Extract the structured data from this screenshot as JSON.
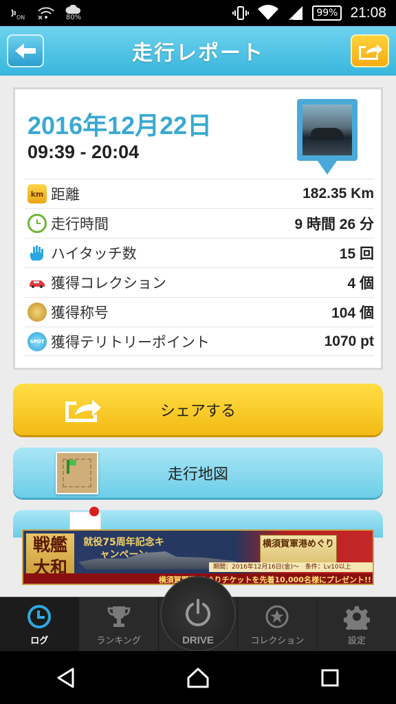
{
  "status_bar": {
    "battery": "99%",
    "time": "21:08",
    "data_label": "80%",
    "on_label": "ON"
  },
  "header": {
    "title": "走行レポート"
  },
  "report": {
    "date": "2016年12月22日",
    "time_range": "09:39 - 20:04",
    "stats": [
      {
        "icon": "km-icon",
        "icon_text": "km",
        "label": "距離",
        "value": "182.35 Km"
      },
      {
        "icon": "clock-icon",
        "icon_text": "",
        "label": "走行時間",
        "value": "9 時間 26 分"
      },
      {
        "icon": "high-touch-hand-icon",
        "icon_text": "",
        "label": "ハイタッチ数",
        "value": "15 回"
      },
      {
        "icon": "car-collection-icon",
        "icon_text": "",
        "label": "獲得コレクション",
        "value": "4 個"
      },
      {
        "icon": "medal-icon",
        "icon_text": "",
        "label": "獲得称号",
        "value": "104 個"
      },
      {
        "icon": "spot-icon",
        "icon_text": "SPOT",
        "label": "獲得テリトリーポイント",
        "value": "1070 pt"
      }
    ]
  },
  "actions": {
    "share_label": "シェアする",
    "map_label": "走行地図"
  },
  "ad": {
    "kanji": "戦艦大和",
    "campaign": "就役75周年記念キャンペーン",
    "port": "横須賀軍港めぐり",
    "period": "期間：2016年12月16日(金)〜　条件：Lv10以上",
    "bottom": "横須賀軍港 めぐりチケットを先着10,000名様にプレゼント!!"
  },
  "bottom_nav": {
    "items": [
      {
        "label": "ログ",
        "active": true
      },
      {
        "label": "ランキング",
        "active": false
      },
      {
        "label": "DRIVE",
        "active": false
      },
      {
        "label": "コレクション",
        "active": false
      },
      {
        "label": "設定",
        "active": false
      }
    ]
  },
  "colors": {
    "header_blue": "#38b6dd",
    "date_blue": "#3aa9d2",
    "share_yellow": "#f3ba14",
    "map_cyan": "#6ccde8"
  }
}
